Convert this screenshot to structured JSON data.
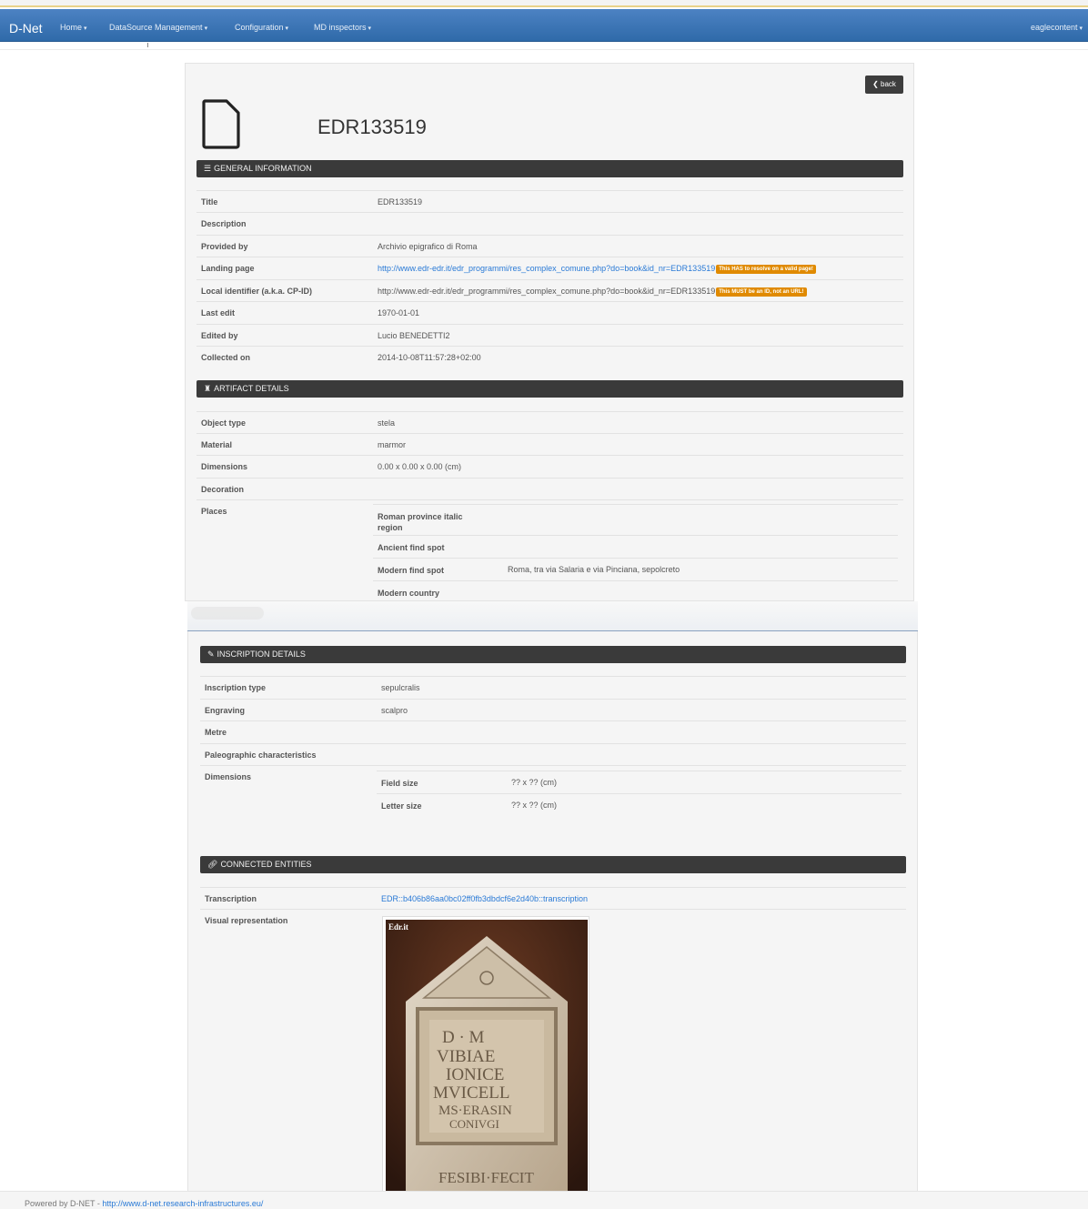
{
  "navbar": {
    "brand": "D-Net",
    "menu": [
      "Home",
      "DataSource Management",
      "Configuration",
      "MD inspectors"
    ],
    "user": "eaglecontent"
  },
  "record": {
    "back_label": "back",
    "title": "EDR133519"
  },
  "general": {
    "header": "GENERAL INFORMATION",
    "title_label": "Title",
    "title_value": "EDR133519",
    "description_label": "Description",
    "provided_by_label": "Provided by",
    "provided_by_value": "Archivio epigrafico di Roma",
    "landing_label": "Landing page",
    "landing_value": "http://www.edr-edr.it/edr_programmi/res_complex_comune.php?do=book&id_nr=EDR133519",
    "landing_badge": "This HAS to resolve on a valid page!",
    "local_id_label": "Local identifier (a.k.a. CP-ID)",
    "local_id_value": "http://www.edr-edr.it/edr_programmi/res_complex_comune.php?do=book&id_nr=EDR133519",
    "local_id_badge": "This MUST be an ID, not an URL!",
    "last_edit_label": "Last edit",
    "last_edit_value": "1970-01-01",
    "edited_by_label": "Edited by",
    "edited_by_value": "Lucio BENEDETTI2",
    "collected_label": "Collected on",
    "collected_value": "2014-10-08T11:57:28+02:00"
  },
  "artifact": {
    "header": "ARTIFACT DETAILS",
    "object_type_label": "Object type",
    "object_type_value": "stela",
    "material_label": "Material",
    "material_value": "marmor",
    "dimensions_label": "Dimensions",
    "dimensions_value": "0.00 x 0.00 x 0.00 (cm)",
    "decoration_label": "Decoration",
    "places_label": "Places",
    "places": {
      "roman_province_label": "Roman province italic region",
      "ancient_find_label": "Ancient find spot",
      "modern_find_label": "Modern find spot",
      "modern_find_value": "Roma, tra via Salaria e via Pinciana, sepolcreto",
      "modern_country_label": "Modern country"
    }
  },
  "inscription": {
    "header": "INSCRIPTION DETAILS",
    "type_label": "Inscription type",
    "type_value": "sepulcralis",
    "engraving_label": "Engraving",
    "engraving_value": "scalpro",
    "metre_label": "Metre",
    "paleo_label": "Paleographic characteristics",
    "dimensions_label": "Dimensions",
    "field_size_label": "Field size",
    "field_size_value": "?? x ?? (cm)",
    "letter_size_label": "Letter size",
    "letter_size_value": "?? x ?? (cm)"
  },
  "connected": {
    "header": "CONNECTED ENTITIES",
    "transcription_label": "Transcription",
    "transcription_value": "EDR::b406b86aa0bc02ff0fb3dbdcf6e2d40b::transcription",
    "visual_label": "Visual representation",
    "image_watermark": "Edr.it"
  },
  "footer": {
    "text": "Powered by D-NET - ",
    "link": "http://www.d-net.research-infrastructures.eu/"
  },
  "colors": {
    "navbar": "#3a75b6",
    "section_bar": "#3a3a3a",
    "badge": "#e08a00",
    "link": "#2a7ad6"
  }
}
